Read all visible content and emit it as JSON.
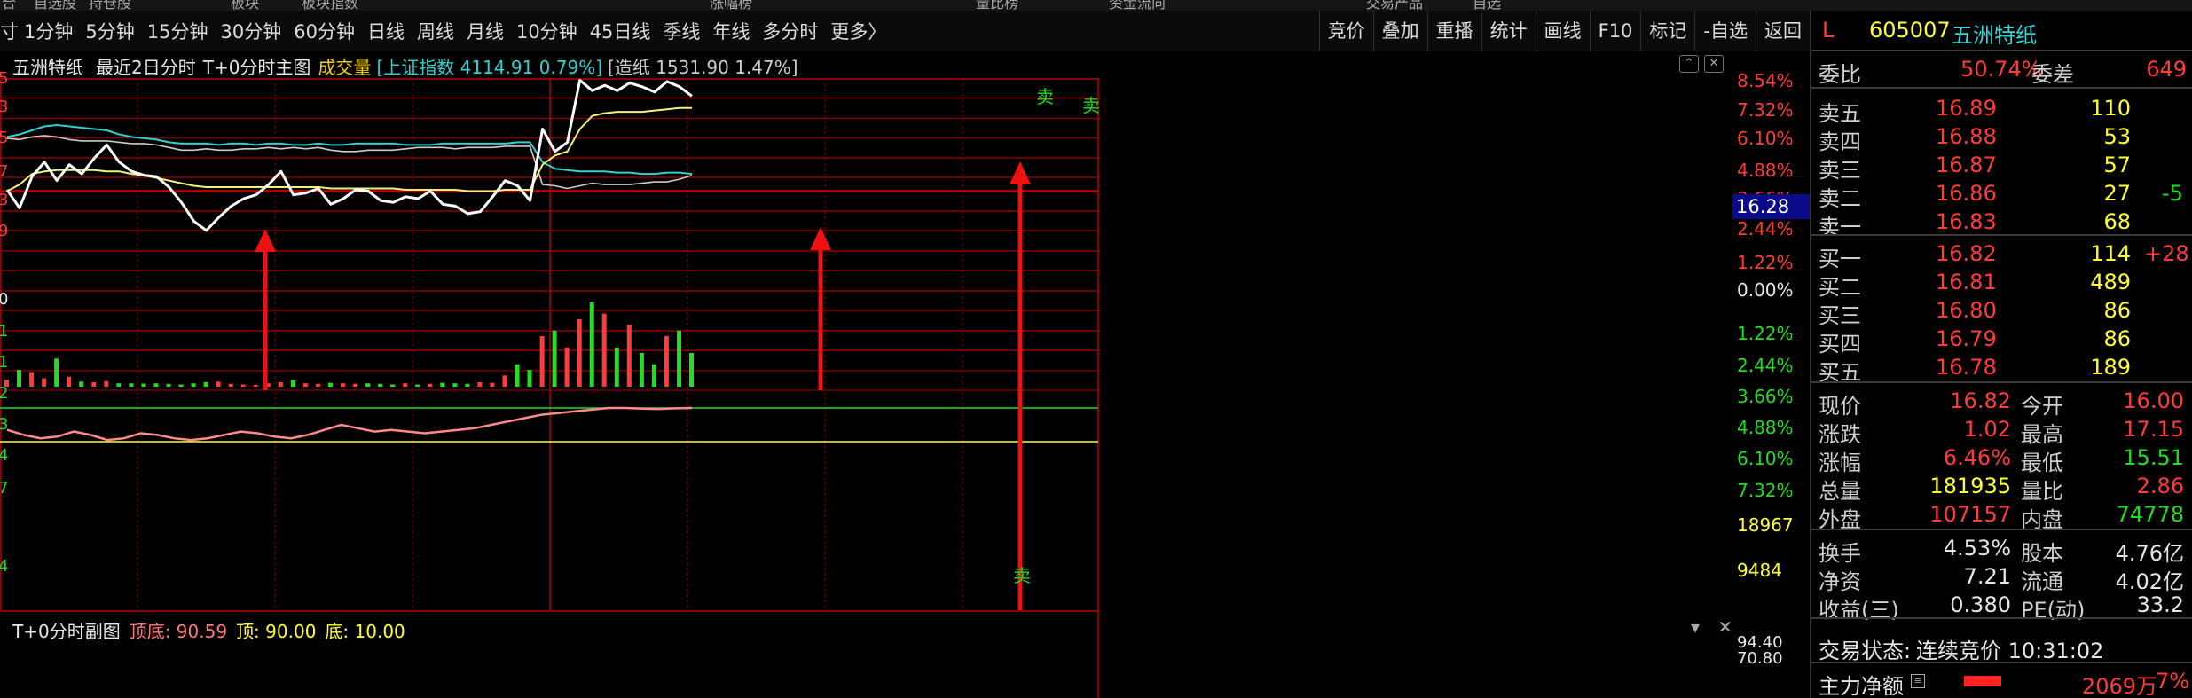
{
  "top_strip": [
    "合",
    "自选股",
    "持仓股",
    "板块",
    "板块指数",
    "涨幅榜",
    "量比榜",
    "资金流向",
    "交易产品",
    "自选"
  ],
  "toolbar": {
    "periods": [
      "1分钟",
      "5分钟",
      "15分钟",
      "30分钟",
      "60分钟",
      "日线",
      "周线",
      "月线",
      "10分钟",
      "45日线",
      "季线",
      "年线",
      "多分时",
      "更多〉"
    ],
    "right_buttons": [
      "竞价",
      "叠加",
      "重播",
      "统计",
      "画线",
      "F10",
      "标记",
      "-自选",
      "返回"
    ]
  },
  "info_bar": {
    "name": "五洲特纸",
    "mode": "最近2日分时",
    "main": "T+0分时主图",
    "vol": "成交量",
    "index": "[上证指数 4114.91 0.79%]",
    "sector": "[造纸 1531.90 1.47%]"
  },
  "axis": {
    "upper": [
      "8.54%",
      "7.32%",
      "6.10%",
      "4.88%",
      "3.66%",
      "2.44%",
      "1.22%",
      "0.00%"
    ],
    "lower": [
      "1.22%",
      "2.44%",
      "3.66%",
      "4.88%",
      "6.10%",
      "7.32%"
    ],
    "current": "16.28",
    "vol": [
      "18967",
      "9484"
    ],
    "sub": [
      "94.40",
      "70.80"
    ],
    "left": [
      "5",
      "3",
      "5",
      "7",
      "3",
      "9",
      "0",
      "1",
      "1",
      "2",
      "3",
      "4",
      "7",
      "4"
    ]
  },
  "sub_chart": {
    "name": "T+0分时副图",
    "top_label": "顶底: 90.59",
    "top": "顶: 90.00",
    "bottom": "底: 10.00"
  },
  "signals": {
    "sell": "卖"
  },
  "chart_data": {
    "type": "line",
    "title": "五洲特纸 最近2日分时 T+0分时主图",
    "ylabel": "%",
    "ylim": [
      -8.54,
      8.54
    ],
    "series": [
      {
        "name": "五洲特纸",
        "values": [
          0.1,
          -0.9,
          1.1,
          2.2,
          0.8,
          2.0,
          1.3,
          2.5,
          3.5,
          2.2,
          1.5,
          1.2,
          1.1,
          0.3,
          -0.6,
          -1.6,
          -2.1,
          -1.4,
          -0.8,
          -0.4,
          -0.2,
          0.5,
          1.5,
          -0.2,
          -0.1,
          0.2,
          -0.7,
          -0.4,
          0.1,
          0.0,
          -0.5,
          -0.6,
          -0.3,
          -0.4,
          0.0,
          -0.7,
          -0.8,
          -1.2,
          -1.1,
          -0.3,
          0.8,
          0.4,
          -0.5,
          4.7,
          3.0,
          3.7,
          8.4,
          7.6,
          8.0,
          7.6,
          8.2,
          7.9,
          7.5,
          8.3,
          7.9,
          7.2
        ]
      },
      {
        "name": "均价",
        "values": [
          0.0,
          0.5,
          1.3,
          1.5,
          1.6,
          1.6,
          1.6,
          1.6,
          1.5,
          1.5,
          1.3,
          1.2,
          1.0,
          0.8,
          0.6,
          0.4,
          0.3,
          0.3,
          0.3,
          0.3,
          0.3,
          0.3,
          0.3,
          0.3,
          0.3,
          0.3,
          0.2,
          0.2,
          0.2,
          0.2,
          0.2,
          0.2,
          0.1,
          0.1,
          0.1,
          0.1,
          0.1,
          0.0,
          0.0,
          0.0,
          0.1,
          0.1,
          0.1,
          2.0,
          2.7,
          3.0,
          4.7,
          5.7,
          5.9,
          6.0,
          6.0,
          6.0,
          6.1,
          6.2,
          6.3,
          6.3
        ]
      },
      {
        "name": "上证指数",
        "values": [
          4.1,
          4.3,
          4.6,
          4.9,
          5.0,
          4.9,
          4.8,
          4.7,
          4.6,
          4.3,
          4.1,
          4.0,
          3.9,
          3.7,
          3.6,
          3.6,
          3.6,
          3.5,
          3.6,
          3.6,
          3.5,
          3.6,
          3.6,
          3.5,
          3.5,
          3.6,
          3.5,
          3.5,
          3.6,
          3.6,
          3.6,
          3.6,
          3.5,
          3.5,
          3.5,
          3.6,
          3.6,
          3.6,
          3.6,
          3.6,
          3.6,
          3.7,
          3.7,
          2.2,
          1.7,
          1.6,
          1.5,
          1.5,
          1.5,
          1.4,
          1.4,
          1.3,
          1.3,
          1.4,
          1.4,
          1.3
        ]
      },
      {
        "name": "造纸",
        "values": [
          4.0,
          3.9,
          4.1,
          4.2,
          4.1,
          3.9,
          3.8,
          3.8,
          3.8,
          3.7,
          3.6,
          3.6,
          3.5,
          3.3,
          3.1,
          3.1,
          3.2,
          3.1,
          3.1,
          3.2,
          3.2,
          3.3,
          3.2,
          3.3,
          3.2,
          3.3,
          3.1,
          3.0,
          3.0,
          3.1,
          3.1,
          3.1,
          3.2,
          3.3,
          3.3,
          3.3,
          3.2,
          3.3,
          3.3,
          3.3,
          3.4,
          3.4,
          3.4,
          0.5,
          0.4,
          0.2,
          0.4,
          0.6,
          0.5,
          0.5,
          0.5,
          0.6,
          0.7,
          0.7,
          0.9,
          1.2
        ]
      }
    ],
    "volume": [
      120,
      300,
      260,
      150,
      500,
      180,
      90,
      80,
      100,
      60,
      60,
      55,
      60,
      50,
      40,
      60,
      80,
      90,
      50,
      40,
      35,
      60,
      80,
      110,
      60,
      50,
      70,
      60,
      50,
      60,
      50,
      40,
      60,
      40,
      50,
      70,
      60,
      50,
      80,
      70,
      200,
      400,
      300,
      900,
      1000,
      700,
      1200,
      1500,
      1300,
      700,
      1100,
      600,
      400,
      900,
      1000,
      600
    ]
  },
  "quote": {
    "code": "605007",
    "name": "五洲特纸",
    "flag": "L",
    "wb_label": "委比",
    "wb": "50.74%",
    "wc_label": "委差",
    "wc": "649",
    "asks": [
      {
        "l": "卖五",
        "p": "16.89",
        "v": "110"
      },
      {
        "l": "卖四",
        "p": "16.88",
        "v": "53"
      },
      {
        "l": "卖三",
        "p": "16.87",
        "v": "57"
      },
      {
        "l": "卖二",
        "p": "16.86",
        "v": "27",
        "x": "-5"
      },
      {
        "l": "卖一",
        "p": "16.83",
        "v": "68"
      }
    ],
    "bids": [
      {
        "l": "买一",
        "p": "16.82",
        "v": "114",
        "x": "+28"
      },
      {
        "l": "买二",
        "p": "16.81",
        "v": "489"
      },
      {
        "l": "买三",
        "p": "16.80",
        "v": "86"
      },
      {
        "l": "买四",
        "p": "16.79",
        "v": "86"
      },
      {
        "l": "买五",
        "p": "16.78",
        "v": "189"
      }
    ],
    "stats": [
      [
        "现价",
        "16.82",
        "今开",
        "16.00"
      ],
      [
        "涨跌",
        "1.02",
        "最高",
        "17.15"
      ],
      [
        "涨幅",
        "6.46%",
        "最低",
        "15.51"
      ],
      [
        "总量",
        "181935",
        "量比",
        "2.86"
      ],
      [
        "外盘",
        "107157",
        "内盘",
        "74778"
      ]
    ],
    "fund": [
      [
        "换手",
        "4.53%",
        "股本",
        "4.76亿"
      ],
      [
        "净资",
        "7.21",
        "流通",
        "4.02亿"
      ],
      [
        "收益(三)",
        "0.380",
        "PE(动)",
        "33.2"
      ]
    ],
    "status_label": "交易状态:",
    "status": "连续竞价 10:31:02",
    "flow_label": "主力净额",
    "flow": "2069万",
    "flow_pct": "7%"
  },
  "colors": {
    "up": "#ff3b3b",
    "down": "#22dd22",
    "grid": "#8a0000",
    "price": "#ffffff",
    "avg": "#f2f27a",
    "index": "#33d0d0",
    "sector": "#cccccc"
  }
}
